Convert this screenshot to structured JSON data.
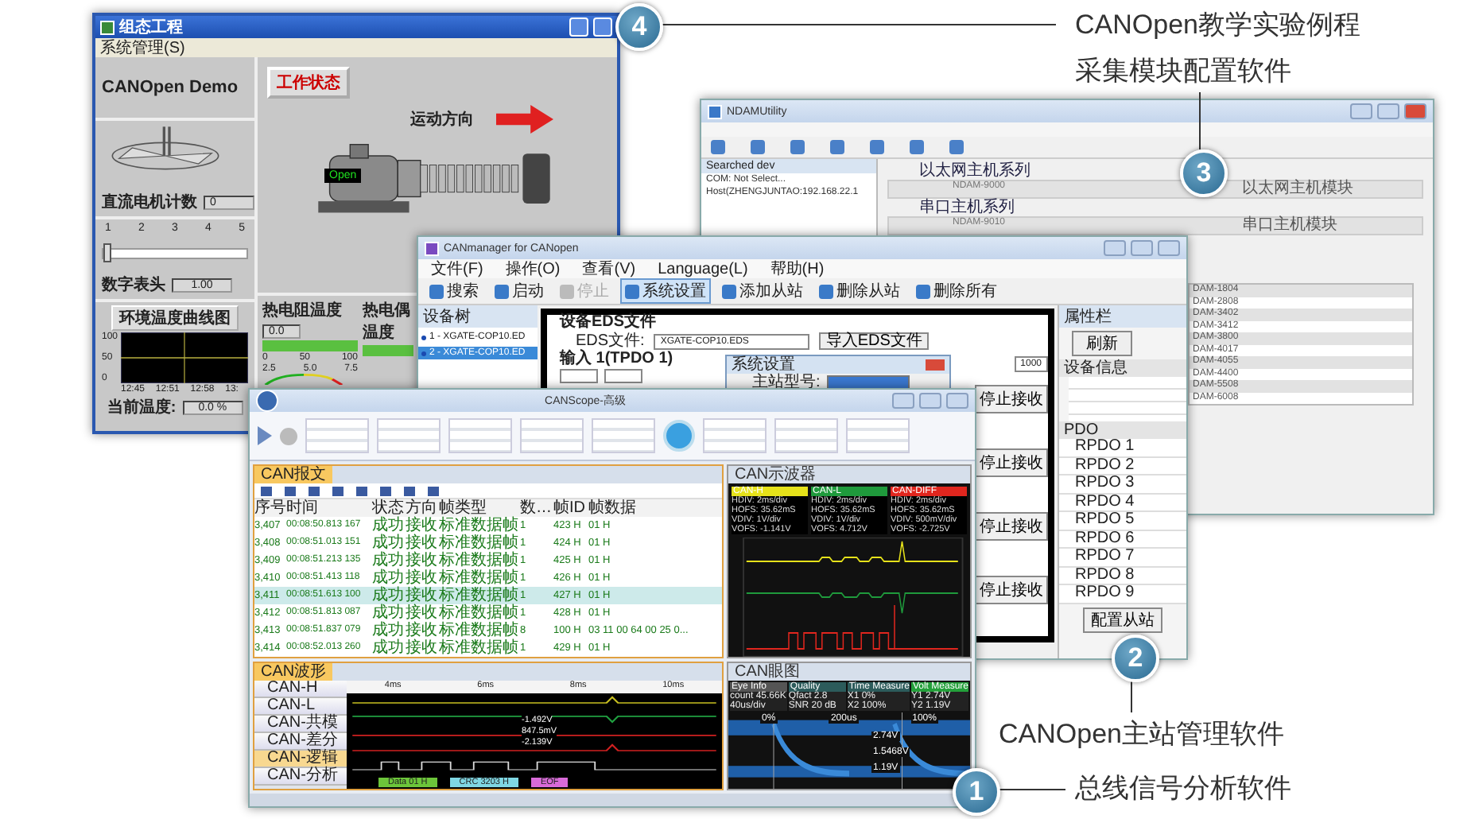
{
  "callouts": [
    {
      "number": "4",
      "label": "CANOpen教学实验例程"
    },
    {
      "number": "3",
      "label": "采集模块配置软件"
    },
    {
      "number": "2",
      "label": "CANOpen主站管理软件"
    },
    {
      "number": "1",
      "label": "总线信号分析软件"
    }
  ],
  "demo_window": {
    "title": "组态工程",
    "menu": [
      "系统管理(S)"
    ],
    "heading": "CANOpen Demo",
    "status_button": "工作状态",
    "direction_label": "运动方向",
    "pump_display": "Open",
    "counter": {
      "label": "直流电机计数",
      "value": "0"
    },
    "scale_ticks": [
      "1",
      "2",
      "3",
      "4",
      "5"
    ],
    "scale": {
      "level": 0.0
    },
    "meter": {
      "label": "数字表头",
      "value": "1.00"
    },
    "trend": {
      "title": "环境温度曲线图",
      "y_ticks": [
        "100",
        "50",
        "0"
      ],
      "x_ticks": [
        "12:45",
        "12:51",
        "12:58",
        "13:"
      ]
    },
    "current_temp": {
      "label": "当前温度:",
      "value": "0.0 %"
    },
    "gauges": [
      {
        "label": "热电阻温度",
        "value": "0.0",
        "level": 1.0,
        "scale": [
          "0",
          "50",
          "100"
        ],
        "dial_ticks": [
          "2.5",
          "5.0",
          "7.5"
        ]
      },
      {
        "label": "热电偶温度",
        "level": 1.0
      }
    ]
  },
  "ndam_window": {
    "title": "NDAMUtility",
    "tree_title": "Searched dev",
    "tree_items": [
      "COM: Not Select...",
      "Host(ZHENGJUNTAO:192.168.22.1"
    ],
    "series": [
      {
        "label": "以太网主机系列",
        "model": "NDAM-9000",
        "description": "以太网主机模块"
      },
      {
        "label": "串口主机系列",
        "model": "NDAM-9010",
        "description": "串口主机模块"
      }
    ],
    "modules": [
      "DAM-1804",
      "DAM-2808",
      "DAM-3402",
      "DAM-3412",
      "DAM-3800",
      "DAM-4017",
      "DAM-4055",
      "DAM-4400",
      "DAM-5508",
      "DAM-6008"
    ]
  },
  "canmanager_window": {
    "title": "CANmanager for CANopen",
    "menu": [
      "文件(F)",
      "操作(O)",
      "查看(V)",
      "Language(L)",
      "帮助(H)"
    ],
    "toolbar": [
      {
        "label": "搜索",
        "selected": false,
        "disabled": false
      },
      {
        "label": "启动",
        "selected": false,
        "disabled": false
      },
      {
        "label": "停止",
        "selected": false,
        "disabled": true
      },
      {
        "label": "系统设置",
        "selected": true,
        "disabled": false
      },
      {
        "label": "添加从站",
        "selected": false,
        "disabled": false
      },
      {
        "label": "删除从站",
        "selected": false,
        "disabled": false
      },
      {
        "label": "删除所有",
        "selected": false,
        "disabled": false
      }
    ],
    "tree_title": "设备树",
    "devices": [
      {
        "label": "1 - XGATE-COP10.ED",
        "selected": false
      },
      {
        "label": "2 - XGATE-COP10.ED",
        "selected": true
      }
    ],
    "eds_section": "设备EDS文件",
    "eds_label": "EDS文件:",
    "eds_value": "XGATE-COP10.EDS",
    "import_button": "导入EDS文件",
    "input_section": "输入 1(TPDO 1)",
    "period_value": "1000",
    "stop_buttons": [
      "停止接收",
      "停止接收",
      "停止接收",
      "停止接收"
    ],
    "dialog": {
      "title": "系统设置",
      "field_label": "主站型号:"
    },
    "properties": {
      "title": "属性栏",
      "refresh": "刷新",
      "info_group": "设备信息",
      "pdo_group": "PDO",
      "pdo_items": [
        "RPDO 1",
        "RPDO 2",
        "RPDO 3",
        "RPDO 4",
        "RPDO 5",
        "RPDO 6",
        "RPDO 7",
        "RPDO 8",
        "RPDO 9"
      ]
    },
    "configure_button": "配置从站"
  },
  "canscope_window": {
    "title": "CANScope-高级",
    "messages": {
      "tab": "CAN报文",
      "columns": [
        "序号",
        "时间",
        "状态",
        "方向",
        "帧类型",
        "数…",
        "帧ID",
        "帧数据"
      ],
      "rows": [
        {
          "index": "3,407",
          "time": "00:08:50.813 167",
          "status": "成功",
          "direction": "接收",
          "frame_type": "标准数据帧",
          "length": "1",
          "id": "423 H",
          "data": "01 H",
          "selected": false
        },
        {
          "index": "3,408",
          "time": "00:08:51.013 151",
          "status": "成功",
          "direction": "接收",
          "frame_type": "标准数据帧",
          "length": "1",
          "id": "424 H",
          "data": "01 H",
          "selected": false
        },
        {
          "index": "3,409",
          "time": "00:08:51.213 135",
          "status": "成功",
          "direction": "接收",
          "frame_type": "标准数据帧",
          "length": "1",
          "id": "425 H",
          "data": "01 H",
          "selected": false
        },
        {
          "index": "3,410",
          "time": "00:08:51.413 118",
          "status": "成功",
          "direction": "接收",
          "frame_type": "标准数据帧",
          "length": "1",
          "id": "426 H",
          "data": "01 H",
          "selected": false
        },
        {
          "index": "3,411",
          "time": "00:08:51.613 100",
          "status": "成功",
          "direction": "接收",
          "frame_type": "标准数据帧",
          "length": "1",
          "id": "427 H",
          "data": "01 H",
          "selected": true
        },
        {
          "index": "3,412",
          "time": "00:08:51.813 087",
          "status": "成功",
          "direction": "接收",
          "frame_type": "标准数据帧",
          "length": "1",
          "id": "428 H",
          "data": "01 H",
          "selected": false
        },
        {
          "index": "3,413",
          "time": "00:08:51.837 079",
          "status": "成功",
          "direction": "接收",
          "frame_type": "标准数据帧",
          "length": "8",
          "id": "100 H",
          "data": "03 11 00 64 00 25 0...",
          "selected": false
        },
        {
          "index": "3,414",
          "time": "00:08:52.013 260",
          "status": "成功",
          "direction": "接收",
          "frame_type": "标准数据帧",
          "length": "1",
          "id": "429 H",
          "data": "01 H",
          "selected": false
        }
      ]
    },
    "scope": {
      "title": "CAN示波器",
      "channels": [
        {
          "name": "CAN-H",
          "color": "#e6e21a",
          "lines": [
            "HDIV: 2ms/div",
            "HOFS: 35.62mS",
            "VDIV: 1V/div",
            "VOFS: -1.141V"
          ]
        },
        {
          "name": "CAN-L",
          "color": "#1f9a3c",
          "lines": [
            "HDIV: 2ms/div",
            "HOFS: 35.62mS",
            "VDIV: 1V/div",
            "VOFS: 4.712V"
          ]
        },
        {
          "name": "CAN-DIFF",
          "color": "#e0261e",
          "lines": [
            "HDIV: 2ms/div",
            "HOFS: 35.62mS",
            "VDIV: 500mV/div",
            "VOFS: -2.725V"
          ]
        }
      ]
    },
    "wave": {
      "title": "CAN波形",
      "ruler": [
        "4ms",
        "6ms",
        "8ms",
        "10ms"
      ],
      "channels": [
        {
          "label": "CAN-H",
          "selected": false
        },
        {
          "label": "CAN-L",
          "selected": false
        },
        {
          "label": "CAN-共模",
          "selected": false
        },
        {
          "label": "CAN-差分",
          "selected": false
        },
        {
          "label": "CAN-逻辑",
          "selected": true
        },
        {
          "label": "CAN-分析",
          "selected": false
        }
      ],
      "measurements": [
        "-1.492V",
        "847.5mV",
        "-2.139V"
      ],
      "segments": [
        {
          "label": "Data 01 H",
          "color": "#6cc53a"
        },
        {
          "label": "CRC 3203 H",
          "color": "#7fd7e3"
        },
        {
          "label": "EOF",
          "color": "#d86ad8"
        }
      ]
    },
    "eye": {
      "title": "CAN眼图",
      "boxes": [
        {
          "title": "Eye Info",
          "color": "#555555",
          "lines": [
            "count 45.66K",
            "40us/div"
          ]
        },
        {
          "title": "Quality",
          "color": "#2c5b5b",
          "lines": [
            "Qfact 2.8",
            "SNR 20 dB"
          ]
        },
        {
          "title": "Time Measure",
          "color": "#2c5b5b",
          "lines": [
            "X1 0%",
            "X2 100%"
          ]
        },
        {
          "title": "Volt Measure",
          "color": "#23a03a",
          "lines": [
            "Y1 2.74V",
            "Y2 1.19V"
          ]
        }
      ],
      "markers": [
        "0%",
        "200us",
        "100%"
      ],
      "levels": [
        "2.74V",
        "1.5468V",
        "1.19V"
      ]
    }
  }
}
